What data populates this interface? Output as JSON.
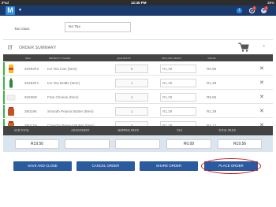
{
  "status_bar": {
    "device": "iPad",
    "time": "12:45 PM",
    "battery": "35%"
  },
  "header": {
    "logo_letter": "M",
    "badge_count": "1",
    "badge_count_user": "1"
  },
  "tax": {
    "label": "Tax Class",
    "value": "No Tax"
  },
  "order_summary": {
    "title": "ORDER SUMMARY"
  },
  "table": {
    "columns": [
      "SKU",
      "PRODUCT NAME",
      "QUANTITY",
      "SELLING PRICE",
      "TOTAL"
    ],
    "rows": [
      {
        "sku": "20493F2",
        "name": "Ice Tea Can (Item)",
        "qty": "5",
        "price": "R1,39",
        "total": "R6,95",
        "thumb_color": "#f2c21a"
      },
      {
        "sku": "20493F1",
        "name": "Ice Tea Bottle (Item)",
        "qty": "1",
        "price": "R1,39",
        "total": "R1,39",
        "thumb_color": "#2f8a3a"
      },
      {
        "sku": "92636G",
        "name": "Feta Cheese (Item)",
        "qty": "4",
        "price": "R1,39",
        "total": "R5,56",
        "thumb_color": "#f4f4f4"
      },
      {
        "sku": "36019K",
        "name": "Smooth Peanut Butter (Item)",
        "qty": "1",
        "price": "R1,39",
        "total": "R1,39",
        "thumb_color": "#c2541f"
      },
      {
        "sku": "36017H",
        "name": "Crunchy Peanut Butter (Item)",
        "qty": "3",
        "price": "R1,39",
        "total": "R4,17",
        "thumb_color": "#c9661e"
      }
    ]
  },
  "summary": {
    "headers": [
      "SUB TOTAL",
      "ADJUSTMENT",
      "SHIPPING PRICE",
      "TAX",
      "TOTAL PRICE"
    ],
    "subtotal": "R19.56",
    "adjustment": "",
    "shipping": "",
    "tax": "R0.00",
    "total": "R19.56"
  },
  "buttons": {
    "save_close": "SAVE AND CLOSE",
    "cancel": "CANCEL ORDER",
    "share": "SHARE ORDER",
    "place": "PLACE ORDER"
  },
  "colors": {
    "header": "#1b3b6f",
    "button": "#2a5aa0",
    "row_marker": "#3bb54a",
    "highlight": "#d21b1b"
  }
}
